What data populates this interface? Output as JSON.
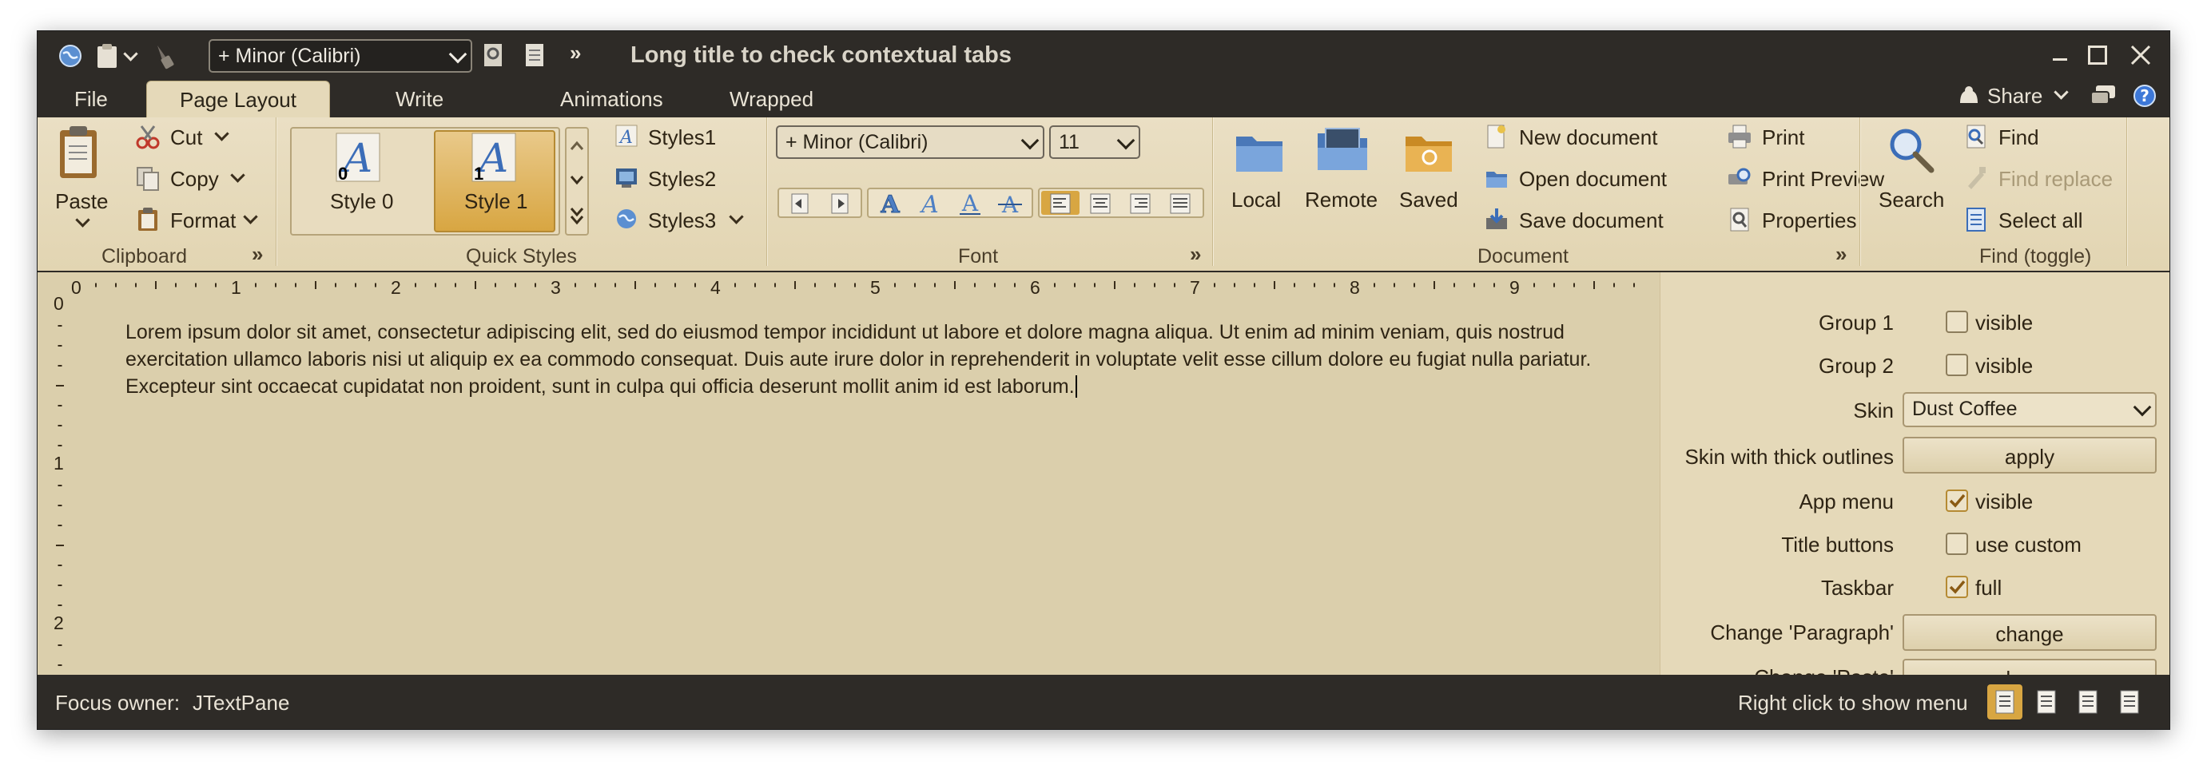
{
  "window": {
    "title": "Long title to check contextual tabs",
    "font_combo": "+ Minor (Calibri)"
  },
  "tabs": [
    {
      "label": "File"
    },
    {
      "label": "Page Layout"
    },
    {
      "label": "Write"
    },
    {
      "label": "Animations"
    },
    {
      "label": "Wrapped"
    }
  ],
  "share_label": "Share",
  "ribbon": {
    "clipboard": {
      "title": "Clipboard",
      "paste": "Paste",
      "cut": "Cut",
      "copy": "Copy",
      "format": "Format"
    },
    "quick_styles": {
      "title": "Quick Styles",
      "style0": "Style 0",
      "style1": "Style 1",
      "style0_num": "0",
      "style1_num": "1",
      "styles1": "Styles1",
      "styles2": "Styles2",
      "styles3": "Styles3"
    },
    "font": {
      "title": "Font",
      "family": "+ Minor (Calibri)",
      "size": "11"
    },
    "document": {
      "title": "Document",
      "local": "Local",
      "remote": "Remote",
      "saved": "Saved",
      "new_document": "New document",
      "open_document": "Open document",
      "save_document": "Save document",
      "print": "Print",
      "print_preview": "Print Preview",
      "properties": "Properties"
    },
    "find": {
      "title": "Find (toggle)",
      "search": "Search",
      "find": "Find",
      "find_replace": "Find replace",
      "select_all": "Select all"
    }
  },
  "ruler": {
    "numbers": [
      "0",
      "1",
      "2",
      "3",
      "4",
      "5",
      "6",
      "7",
      "8",
      "9"
    ],
    "vertical": [
      "0",
      "1",
      "2"
    ]
  },
  "document_text": "Lorem ipsum dolor sit amet, consectetur adipiscing elit, sed do eiusmod tempor incididunt ut labore et dolore magna aliqua. Ut enim ad minim veniam, quis nostrud exercitation ullamco laboris nisi ut aliquip ex ea commodo consequat. Duis aute irure dolor in reprehenderit in voluptate velit esse cillum dolore eu fugiat nulla pariatur. Excepteur sint occaecat cupidatat non proident, sunt in culpa qui officia deserunt mollit anim id est laborum.",
  "panel": {
    "group1_label": "Group 1",
    "group1_value": "visible",
    "group1_checked": false,
    "group2_label": "Group 2",
    "group2_value": "visible",
    "group2_checked": false,
    "skin_label": "Skin",
    "skin_value": "Dust Coffee",
    "thick_label": "Skin with thick outlines",
    "thick_button": "apply",
    "appmenu_label": "App menu",
    "appmenu_value": "visible",
    "appmenu_checked": true,
    "titlebuttons_label": "Title buttons",
    "titlebuttons_value": "use custom",
    "titlebuttons_checked": false,
    "taskbar_label": "Taskbar",
    "taskbar_value": "full",
    "taskbar_checked": true,
    "paragraph_label": "Change 'Paragraph'",
    "paragraph_button": "change",
    "paste_label": "Change 'Paste'",
    "paste_button": "change"
  },
  "status": {
    "focus_label": "Focus owner:",
    "focus_value": "JTextPane",
    "hint": "Right click to show menu"
  },
  "colors": {
    "chrome_dark": "#2e2b27",
    "ribbon_bg": "#e5d9b9",
    "editor_bg": "#dbcfac",
    "accent": "#d8a642"
  }
}
